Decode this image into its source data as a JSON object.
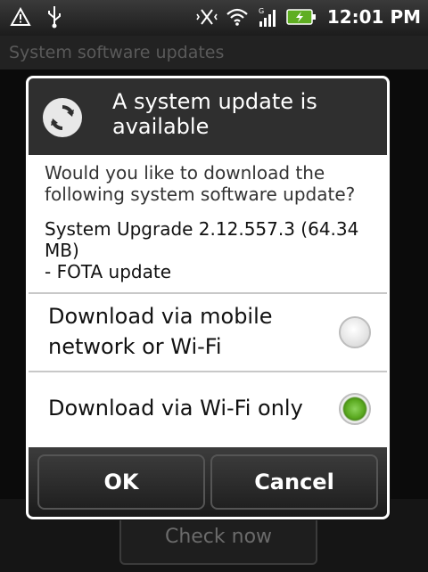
{
  "status_bar": {
    "left_icons": [
      "warning-icon",
      "usb-icon"
    ],
    "right_icons": [
      "vibrate-icon",
      "wifi-icon",
      "signal-icon",
      "battery-icon"
    ],
    "time": "12:01 PM"
  },
  "app": {
    "title": "System software updates",
    "check_now_label": "Check now"
  },
  "dialog": {
    "title": "A system update is available",
    "message": "Would you like to download the following system software update?",
    "detail_line1": "System Upgrade 2.12.557.3 (64.34 MB)",
    "detail_line2": "- FOTA update",
    "options": [
      {
        "label": "Download via mobile network or Wi-Fi",
        "selected": false
      },
      {
        "label": "Download via Wi-Fi only",
        "selected": true
      }
    ],
    "ok_label": "OK",
    "cancel_label": "Cancel"
  },
  "colors": {
    "accent_selected": "#5fae22",
    "header_bg": "#2f2f2f"
  }
}
